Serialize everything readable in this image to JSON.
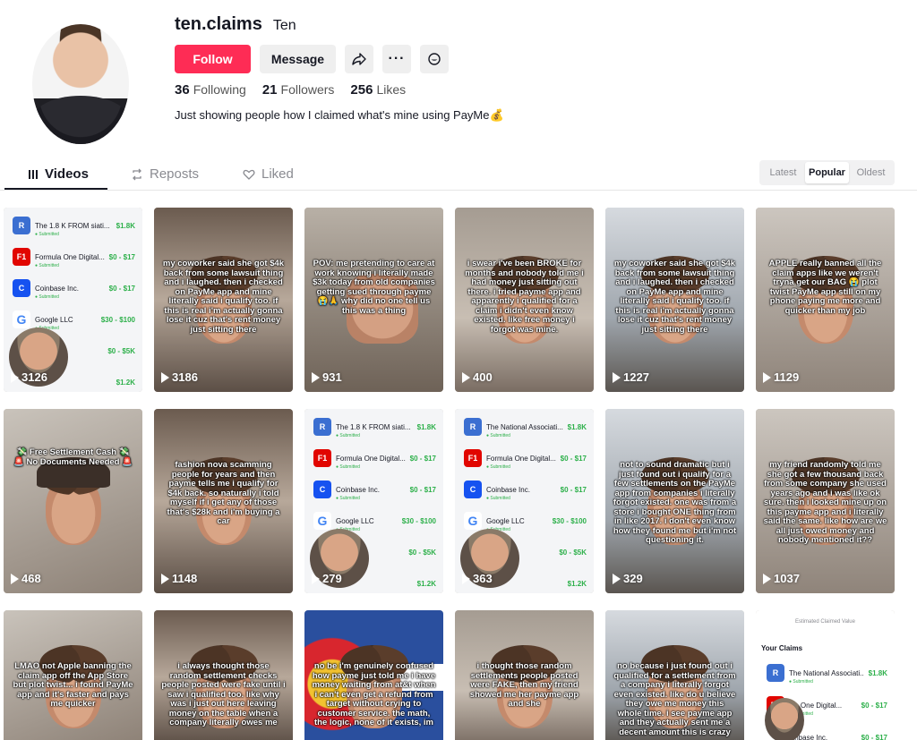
{
  "profile": {
    "username": "ten.claims",
    "nickname": "Ten",
    "follow_label": "Follow",
    "message_label": "Message",
    "following_count": "36",
    "following_label": "Following",
    "followers_count": "21",
    "followers_label": "Followers",
    "likes_count": "256",
    "likes_label": "Likes",
    "bio": "Just showing people how I claimed what's mine using PayMe💰"
  },
  "tabs": {
    "videos": "Videos",
    "reposts": "Reposts",
    "liked": "Liked"
  },
  "sort": {
    "latest": "Latest",
    "popular": "Popular",
    "oldest": "Oldest",
    "selected": "Popular"
  },
  "videos": [
    {
      "views": "3126",
      "kind": "claims",
      "text": ""
    },
    {
      "views": "3186",
      "kind": "face",
      "text": "my coworker said she got $4k back from some lawsuit thing and i laughed. then i checked on PayMe app and mine literally said i qualify too. if this is real i'm actually gonna lose it cuz that's rent money just sitting there"
    },
    {
      "views": "931",
      "kind": "hand",
      "text": "POV: me pretending to care at work knowing i literally made $3k today from old companies getting sued through payme 😭🙏 why did no one tell us this was a thing"
    },
    {
      "views": "400",
      "kind": "face",
      "text": "i swear i've been BROKE for months and nobody told me i had money just sitting out there. i tried payme app and apparently i qualified for a claim i didn't even know existed. like free money i forgot was mine."
    },
    {
      "views": "1227",
      "kind": "face",
      "text": "my coworker said she got $4k back from some lawsuit thing and i laughed. then i checked on PayMe app and mine literally said i qualify too. if this is real i'm actually gonna lose it cuz that's rent money just sitting there"
    },
    {
      "views": "1129",
      "kind": "face",
      "text": "APPLE really banned all the claim apps like we weren't tryna get our BAG 😭 plot twist PayMe app still on my phone paying me more and quicker than my job"
    },
    {
      "views": "468",
      "kind": "cap",
      "text": "💸 Free Settlement Cash 💸 🚨 No Documents Needed 🚨"
    },
    {
      "views": "1148",
      "kind": "face",
      "text": "fashion nova scamming people for years and then payme tells me i qualify for $4k back. so naturally i told myself if i get any of those that's $28k and i'm buying a car"
    },
    {
      "views": "279",
      "kind": "claims",
      "text": ""
    },
    {
      "views": "363",
      "kind": "claims2",
      "text": ""
    },
    {
      "views": "329",
      "kind": "face",
      "text": "not to sound dramatic but i just found out i qualify for a few settlements on the PayMe app from companies i literally forgot existed. one was from a store i bought ONE thing from in like 2017. i don't even know how they found me but i'm not questioning it."
    },
    {
      "views": "1037",
      "kind": "face",
      "text": "my friend randomly told me she got a few thousand back from some company she used years ago and i was like ok sure. then i looked mine up on this payme app and i literally said the same. like how are we all just owed money and nobody mentioned it??"
    },
    {
      "views": "",
      "kind": "face",
      "text": "LMAO not Apple banning the claim app off the App Store but plot twist... i found PayMe app and it's faster and pays me quicker"
    },
    {
      "views": "",
      "kind": "face",
      "text": "i always thought those random settlement checks people posted were fake until i saw i qualified too. like why was i just out here leaving money on the table when a company literally owes me"
    },
    {
      "views": "",
      "kind": "flag",
      "text": "no be i'm genuinely confused how payme just told me i have money waiting from at&t when i can't even get a refund from target without crying to customer service. the math, the logic, none of it exists, im"
    },
    {
      "views": "",
      "kind": "face",
      "text": "i thought those random settlements people posted were FAKE, then my friend showed me her payme app and she"
    },
    {
      "views": "",
      "kind": "face",
      "text": "no because i just found out i qualified for a settlement from a company i literally forgot even existed. like do u believe they owe me money this whole time. i see payme app and they actually sent me a decent amount this is crazy"
    },
    {
      "views": "",
      "kind": "yourclaims",
      "text": ""
    }
  ],
  "claims_list": [
    {
      "name": "The 1.8 K FROM siati...",
      "amount": "$1.8K",
      "status": "Submitted",
      "logo_color": "#3b6fd1",
      "logo": "R"
    },
    {
      "name": "Formula One Digital...",
      "amount": "$0 - $17",
      "status": "Submitted",
      "logo_color": "#e10600",
      "logo": "F1"
    },
    {
      "name": "Coinbase Inc.",
      "amount": "$0 - $17",
      "status": "Submitted",
      "logo_color": "#1652f0",
      "logo": "C"
    },
    {
      "name": "Google LLC",
      "amount": "$30 - $100",
      "status": "Submitted",
      "logo_color": "#ffffff",
      "logo": "G"
    },
    {
      "name": "",
      "amount": "$0 - $5K",
      "status": "",
      "logo_color": "#ffffff",
      "logo": ""
    },
    {
      "name": "Inc.",
      "amount": "$1.2K",
      "status": "",
      "logo_color": "#ffffff",
      "logo": ""
    }
  ],
  "claims_list_2": [
    {
      "name": "The National Associati...",
      "amount": "$1.8K",
      "status": "Submitted",
      "logo_color": "#3b6fd1",
      "logo": "R"
    },
    {
      "name": "Formula One Digital...",
      "amount": "$0 - $17",
      "status": "Submitted",
      "logo_color": "#e10600",
      "logo": "F1"
    },
    {
      "name": "Coinbase Inc.",
      "amount": "$0 - $17",
      "status": "Submitted",
      "logo_color": "#1652f0",
      "logo": "C"
    },
    {
      "name": "Google LLC",
      "amount": "$30 - $100",
      "status": "Submitted",
      "logo_color": "#ffffff",
      "logo": "G"
    },
    {
      "name": "T Inc.",
      "amount": "$0 - $5K",
      "status": "",
      "logo_color": "#ffffff",
      "logo": ""
    },
    {
      "name": "Inc.",
      "amount": "$1.2K",
      "status": "",
      "logo_color": "#ffffff",
      "logo": ""
    }
  ],
  "your_claims_panel": {
    "estimated_label": "Estimated Claimed Value",
    "title": "Your Claims",
    "rows": [
      {
        "name": "The National Associati...",
        "amount": "$1.8K",
        "status": "Submitted",
        "logo": "R",
        "logo_color": "#3b6fd1"
      },
      {
        "name": "ula One Digital...",
        "amount": "$0 - $17",
        "status": "Submitted",
        "logo": "F1",
        "logo_color": "#e10600"
      },
      {
        "name": "oinbase Inc.",
        "amount": "$0 - $17",
        "status": "",
        "logo": "",
        "logo_color": "#1652f0"
      }
    ]
  },
  "colors": {
    "accent": "#fe2c55",
    "text": "#161823",
    "muted": "#8a8b91"
  }
}
